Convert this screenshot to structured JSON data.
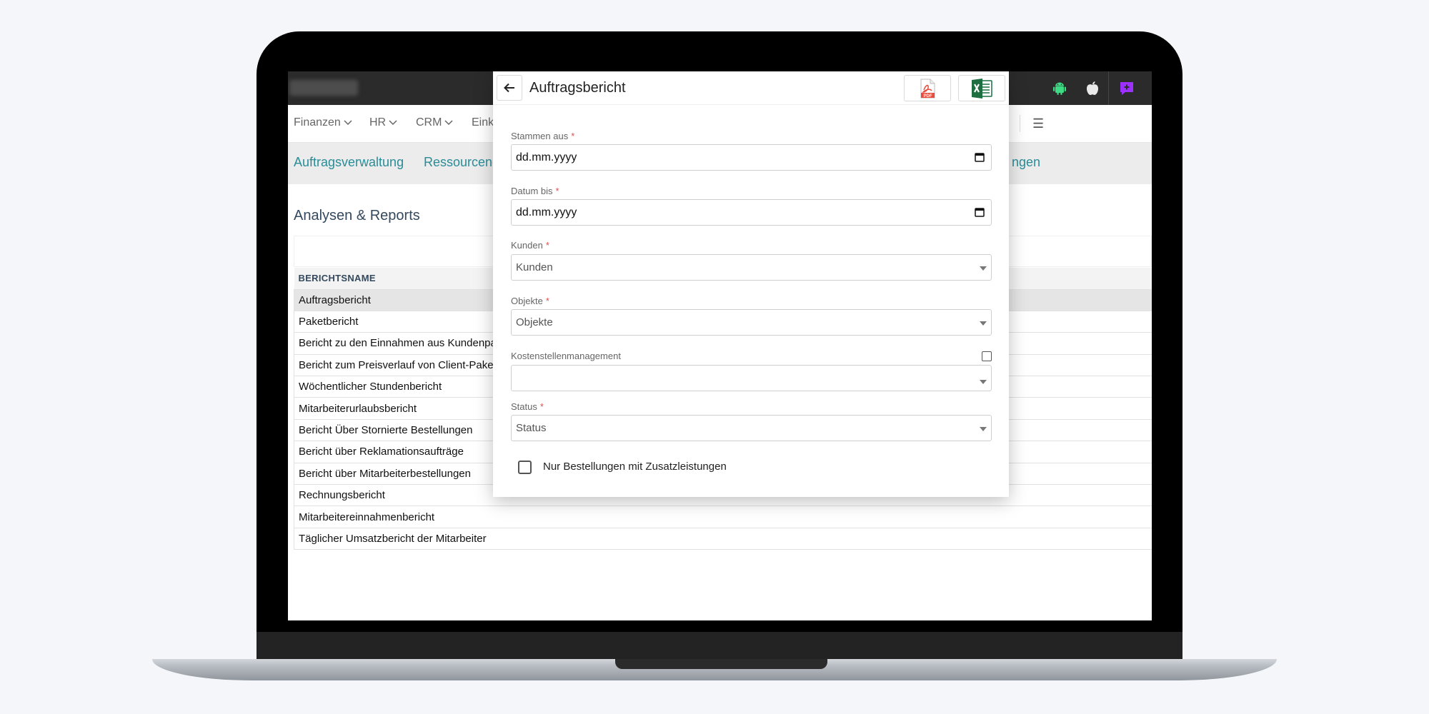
{
  "modal": {
    "title": "Auftragsbericht",
    "export_pdf_label": "PDF",
    "fields": {
      "date_from": {
        "label": "Stammen aus",
        "required_mark": "*",
        "value": "dd.mm.yyyy"
      },
      "date_to": {
        "label": "Datum bis",
        "required_mark": "*",
        "value": "dd.mm.yyyy"
      },
      "customers": {
        "label": "Kunden",
        "required_mark": "*",
        "value": "Kunden"
      },
      "objects": {
        "label": "Objekte",
        "required_mark": "*",
        "value": "Objekte"
      },
      "cost_center": {
        "label": "Kostenstellenmanagement",
        "value": ""
      },
      "status": {
        "label": "Status",
        "required_mark": "*",
        "value": "Status"
      }
    },
    "only_extra_services_label": "Nur Bestellungen mit Zusatzleistungen"
  },
  "menubar": {
    "items": [
      "Finanzen",
      "HR",
      "CRM",
      "Eink"
    ]
  },
  "subnav": {
    "items": [
      "Auftragsverwaltung",
      "Ressourcen-",
      "ngen"
    ]
  },
  "page": {
    "section_title": "Analysen & Reports"
  },
  "report_table": {
    "header": "BERICHTSNAME",
    "rows": [
      "Auftragsbericht",
      "Paketbericht",
      "Bericht zu den Einnahmen aus Kundenpa",
      "Bericht zum Preisverlauf von Client-Pake",
      "Wöchentlicher Stundenbericht",
      "Mitarbeiterurlaubsbericht",
      "Bericht Über Stornierte Bestellungen",
      "Bericht über Reklamationsaufträge",
      "Bericht über Mitarbeiterbestellungen",
      "Rechnungsbericht",
      "Mitarbeitereinnahmenbericht",
      "Täglicher Umsatzbericht der Mitarbeiter"
    ]
  },
  "colors": {
    "topbar": "#2b2b2b",
    "link_teal": "#2a8c97",
    "android_green": "#3ddc84",
    "purple_accent": "#9b30ff",
    "excel_green": "#1d6f42",
    "pdf_red": "#e74c3c",
    "required_red": "#d9534f"
  },
  "icons": {
    "topbar": [
      "android-icon",
      "apple-icon",
      "chat-icon"
    ],
    "modal": [
      "back-arrow-icon",
      "pdf-icon",
      "excel-icon",
      "calendar-icon",
      "dropdown-caret-icon"
    ],
    "menubar": [
      "chevron-down-icon",
      "hamburger-menu-icon"
    ]
  }
}
